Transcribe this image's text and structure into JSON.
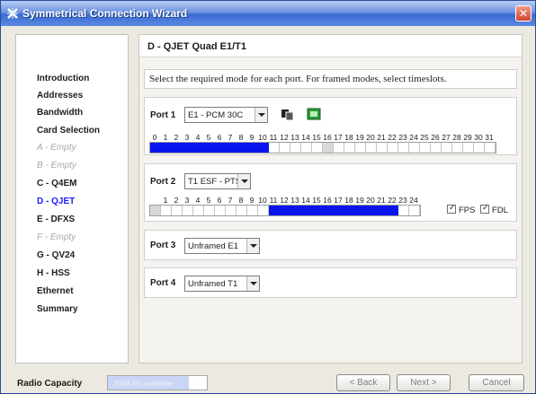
{
  "window": {
    "title": "Symmetrical Connection Wizard"
  },
  "sidebar": {
    "items": [
      {
        "label": "Introduction",
        "state": "normal"
      },
      {
        "label": "Addresses",
        "state": "normal"
      },
      {
        "label": "Bandwidth",
        "state": "normal"
      },
      {
        "label": "Card Selection",
        "state": "normal"
      },
      {
        "label": "A - Empty",
        "state": "disabled"
      },
      {
        "label": "B - Empty",
        "state": "disabled"
      },
      {
        "label": "C - Q4EM",
        "state": "normal"
      },
      {
        "label": "D - QJET",
        "state": "active"
      },
      {
        "label": "E - DFXS",
        "state": "normal"
      },
      {
        "label": "F - Empty",
        "state": "disabled"
      },
      {
        "label": "G - QV24",
        "state": "normal"
      },
      {
        "label": "H - HSS",
        "state": "normal"
      },
      {
        "label": "Ethernet",
        "state": "normal"
      },
      {
        "label": "Summary",
        "state": "normal"
      }
    ]
  },
  "main": {
    "title": "D - QJET Quad E1/T1",
    "instructions": "Select the required mode for each port. For framed modes, select timeslots.",
    "ports": [
      {
        "label": "Port 1",
        "mode": "E1 - PCM 30C",
        "timeslot_labels": [
          "0",
          "1",
          "2",
          "3",
          "4",
          "5",
          "6",
          "7",
          "8",
          "9",
          "10",
          "11",
          "12",
          "13",
          "14",
          "15",
          "16",
          "17",
          "18",
          "19",
          "20",
          "21",
          "22",
          "23",
          "24",
          "25",
          "26",
          "27",
          "28",
          "29",
          "30",
          "31"
        ],
        "selected_timeslots": [
          0,
          1,
          2,
          3,
          4,
          5,
          6,
          7,
          8,
          9,
          10
        ],
        "unavailable_timeslots": [
          16
        ]
      },
      {
        "label": "Port 2",
        "mode": "T1 ESF - PTS",
        "timeslot_labels": [
          "1",
          "2",
          "3",
          "4",
          "5",
          "6",
          "7",
          "8",
          "9",
          "10",
          "11",
          "12",
          "13",
          "14",
          "15",
          "16",
          "17",
          "18",
          "19",
          "20",
          "21",
          "22",
          "23",
          "24"
        ],
        "selected_timeslots": [
          10,
          11,
          12,
          13,
          14,
          15,
          16,
          17,
          18,
          19,
          20,
          21
        ],
        "checkboxes": [
          {
            "label": "FPS",
            "checked": true
          },
          {
            "label": "FDL",
            "checked": true
          }
        ]
      },
      {
        "label": "Port 3",
        "mode": "Unframed E1"
      },
      {
        "label": "Port 4",
        "mode": "Unframed T1"
      }
    ]
  },
  "footer": {
    "radio_capacity_label": "Radio Capacity",
    "capacity_text": "2048 kb available",
    "capacity_fraction": 0.82,
    "back_label": "< Back",
    "next_label": "Next >",
    "cancel_label": "Cancel"
  },
  "colors": {
    "selected_timeslot": "#0a14ec",
    "active_nav": "#1c1cff",
    "titlebar": "#3a6bd2"
  }
}
